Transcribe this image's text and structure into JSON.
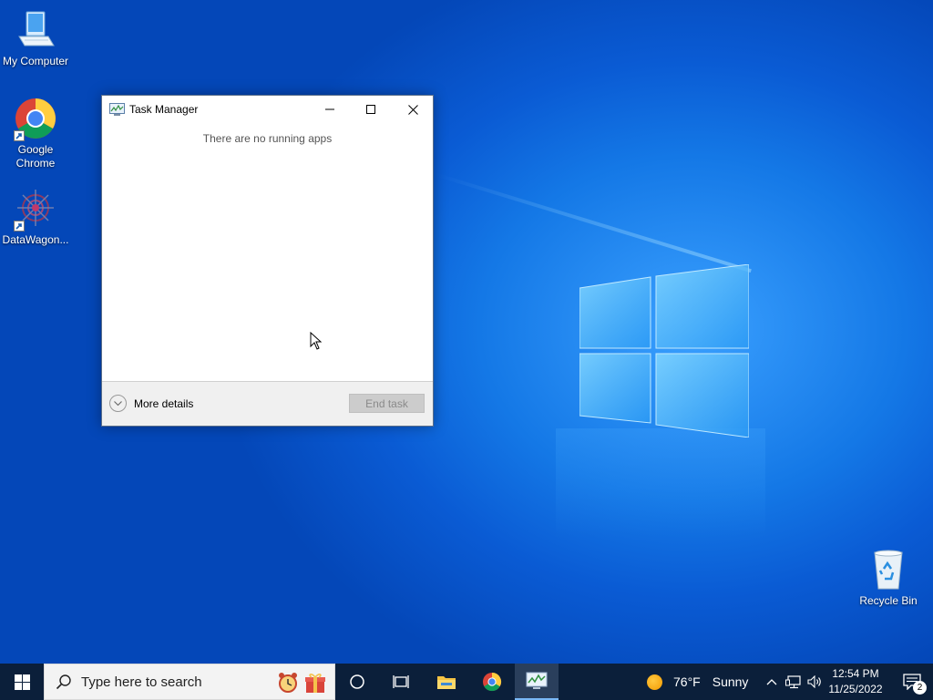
{
  "desktop": {
    "icons": [
      {
        "label": "My Computer",
        "icon": "computer-icon"
      },
      {
        "label": "Google Chrome",
        "icon": "chrome-icon"
      },
      {
        "label": "DataWagon...",
        "icon": "datawagon-icon"
      },
      {
        "label": "Recycle Bin",
        "icon": "recycle-bin-icon"
      }
    ]
  },
  "task_manager": {
    "title": "Task Manager",
    "empty_message": "There are no running apps",
    "more_details_label": "More details",
    "end_task_label": "End task",
    "end_task_enabled": false
  },
  "taskbar": {
    "search_placeholder": "Type here to search",
    "pinned": [
      "cortana-icon",
      "task-view-icon",
      "file-explorer-icon",
      "chrome-icon",
      "task-manager-icon"
    ],
    "active_app": "task-manager-icon",
    "weather": {
      "temp": "76°F",
      "condition": "Sunny"
    },
    "clock": {
      "time": "12:54 PM",
      "date": "11/25/2022"
    },
    "notifications_count": "2"
  },
  "colors": {
    "desktop_blue": "#0a5bd4",
    "taskbar": "#0b1f3a",
    "window_border": "#5a6e8a"
  }
}
